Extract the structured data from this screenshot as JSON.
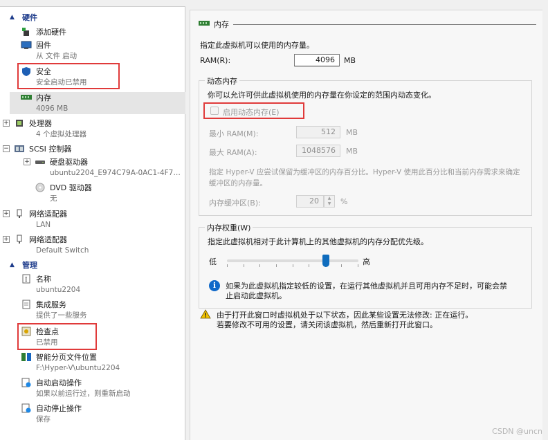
{
  "sidebar": {
    "hardware_header": "硬件",
    "management_header": "管理",
    "items": [
      {
        "label": "添加硬件",
        "sub": ""
      },
      {
        "label": "固件",
        "sub": "从 文件 启动"
      },
      {
        "label": "安全",
        "sub": "安全启动已禁用"
      },
      {
        "label": "内存",
        "sub": "4096 MB"
      },
      {
        "label": "处理器",
        "sub": "4 个虚拟处理器"
      },
      {
        "label": "SCSI 控制器",
        "sub": ""
      },
      {
        "label": "硬盘驱动器",
        "sub": "ubuntu2204_E974C79A-0AC1-4F7F-..."
      },
      {
        "label": "DVD 驱动器",
        "sub": "无"
      },
      {
        "label": "网络适配器",
        "sub": "LAN"
      },
      {
        "label": "网络适配器",
        "sub": "Default Switch"
      }
    ],
    "mgmt_items": [
      {
        "label": "名称",
        "sub": "ubuntu2204"
      },
      {
        "label": "集成服务",
        "sub": "提供了一些服务"
      },
      {
        "label": "检查点",
        "sub": "已禁用"
      },
      {
        "label": "智能分页文件位置",
        "sub": "F:\\Hyper-V\\ubuntu2204"
      },
      {
        "label": "自动启动操作",
        "sub": "如果以前运行过，则重新启动"
      },
      {
        "label": "自动停止操作",
        "sub": "保存"
      }
    ]
  },
  "panel": {
    "title": "内存",
    "desc": "指定此虚拟机可以使用的内存量。",
    "ram_label": "RAM(R):",
    "ram_value": "4096",
    "ram_unit": "MB",
    "dynamic": {
      "legend": "动态内存",
      "desc": "你可以允许可供此虚拟机使用的内存量在你设定的范围内动态变化。",
      "enable_label": "启用动态内存(E)",
      "enabled": false,
      "min_label": "最小 RAM(M):",
      "min_value": "512",
      "max_label": "最大 RAM(A):",
      "max_value": "1048576",
      "unit": "MB",
      "buffer_desc_1": "指定 Hyper-V 应尝试保留为缓冲区的内存百分比。Hyper-V 使用此百分比和当前内存需求来确定",
      "buffer_desc_2": "缓冲区的内存量。",
      "buffer_label": "内存缓冲区(B):",
      "buffer_value": "20",
      "buffer_unit": "%"
    },
    "weight": {
      "legend": "内存权重(W)",
      "desc": "指定此虚拟机相对于此计算机上的其他虚拟机的内存分配优先级。",
      "low": "低",
      "high": "高",
      "level": 0.75,
      "info_1": "如果为此虚拟机指定较低的设置，在运行其他虚拟机并且可用内存不足时，可能会禁",
      "info_2": "止启动此虚拟机。"
    },
    "warning_1": "由于打开此窗口时虚拟机处于以下状态，因此某些设置无法修改: 正在运行。",
    "warning_2": "若要修改不可用的设置，请关闭该虚拟机，然后重新打开此窗口。"
  },
  "watermark": "CSDN @uncn",
  "colors": {
    "accent": "#0f6cbd",
    "highlight_box": "#e03a3a",
    "section_header": "#1f3d8c"
  }
}
